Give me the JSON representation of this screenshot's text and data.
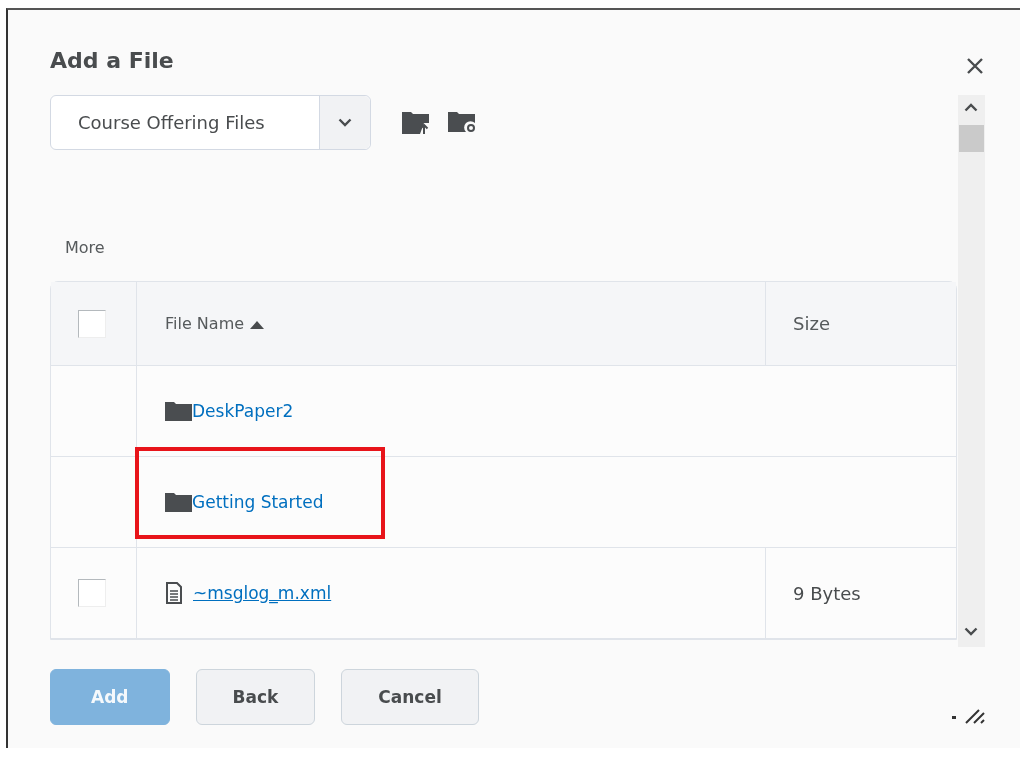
{
  "dialog": {
    "title": "Add a File"
  },
  "source_select": {
    "value": "Course Offering Files"
  },
  "more_link": "More",
  "table": {
    "columns": [
      {
        "label": "File Name",
        "sorted": true
      },
      {
        "label": "Size"
      }
    ],
    "select_all": {
      "checked": false
    },
    "rows": [
      {
        "kind": "folder",
        "name": "DeskPaper2",
        "highlighted": false
      },
      {
        "kind": "folder",
        "name": "Getting Started",
        "highlighted": true
      },
      {
        "kind": "file",
        "name": "~msglog_m.xml",
        "size": "9 Bytes",
        "checked": false,
        "highlighted": false
      }
    ]
  },
  "buttons": [
    {
      "label": "Add",
      "kind": "primary",
      "disabled": true
    },
    {
      "label": "Back",
      "kind": "secondary",
      "disabled": false
    },
    {
      "label": "Cancel",
      "kind": "secondary",
      "disabled": false
    }
  ]
}
